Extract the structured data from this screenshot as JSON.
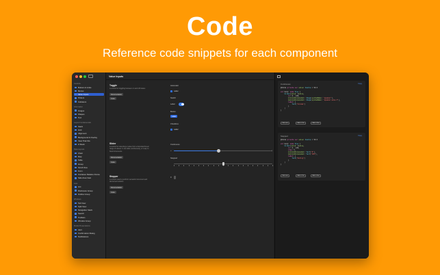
{
  "hero": {
    "title": "Code",
    "subtitle": "Reference code snippets for each component"
  },
  "window": {
    "title": "Value Inputs"
  },
  "sidebar": {
    "sections": [
      {
        "label": "Controls",
        "items": [
          "Buttons & Links",
          "Menus",
          "Value Inputs",
          "Pickers",
          "Indicators"
        ]
      },
      {
        "label": "Information",
        "items": [
          "Images",
          "Shapes",
          "Text"
        ]
      },
      {
        "label": "Layout Fundamentals",
        "items": [
          "Stack",
          "Grid",
          "Alignment",
          "Background & Overlay",
          "View That Fits",
          "Z-Stack"
        ]
      },
      {
        "label": "Data Layouts",
        "items": [
          "Chart",
          "Map",
          "Table",
          "Group",
          "Scroll View",
          "Form",
          "Container Relative Frame",
          "Safe Area Inset"
        ]
      },
      {
        "label": "Lists",
        "items": [
          "List",
          "Disclosure Group",
          "Outline Group"
        ]
      },
      {
        "label": "Windows",
        "items": [
          "Tab View",
          "Split View",
          "Navigation Stack",
          "Search",
          "Toolbars",
          "Window Group"
        ]
      },
      {
        "label": "Modal Presentations",
        "items": [
          "Alert",
          "Confirmation Dialog",
          "Notifications"
        ]
      }
    ],
    "selected": "Value Inputs"
  },
  "toggle": {
    "heading": "Toggle",
    "description": "A control for toggling between on and off states.",
    "doc_button": "Documentation",
    "code_button": "Code",
    "automatic_label": "Automatic",
    "automatic_check": "Label",
    "switch_label": "Switch",
    "switch_text": "Label",
    "button_label": "Button",
    "button_text": "Label",
    "checkbox_label": "Checkbox",
    "checkbox_check": "Label"
  },
  "slider": {
    "heading": "Slider",
    "description": "A control for selecting a value from a bounded linear range of values. It can slide continuously, or snap to fixed increments.",
    "doc_button": "Documentation",
    "code_button": "Code",
    "continuous_label": "Continuous",
    "continuous_value": 0.46,
    "stepped_label": "Stepped",
    "stepped_value": 0.5
  },
  "stepper": {
    "heading": "Stepper",
    "description": "A control used to perform semantic increment and decrement actions.",
    "doc_button": "Documentation",
    "code_button": "Code",
    "value": "0"
  },
  "code_panel": {
    "card1": {
      "title": "Continuous",
      "copy": "Copy",
      "lines": [
        "@State private var value: Double = 50.0",
        "",
        "var body: some View {",
        "    Slider(value: $value,",
        "        in: 0...100,",
        "        minimumValueLabel: Image(systemName: \"speaker\"),",
        "        maximumValueLabel: Image(systemName: \"speaker.wave.3\"),",
        "        label: {",
        "            Text(\"Volume\")",
        "        }",
        "    )",
        "}"
      ],
      "buttons": [
        "Edit view",
        "Add to Tab",
        "Add to Box"
      ]
    },
    "card2": {
      "title": "Stepped",
      "copy": "Copy",
      "lines": [
        "@State private var value: Double = 50.0",
        "",
        "var body: some View {",
        "    Slider(value: $value,",
        "        in: 0...100,",
        "        step: 5,",
        "        minimumValueLabel: Text(\"0\"),",
        "        maximumValueLabel: Text(\"100\"),",
        "        label: {",
        "            Text(\"Rating\")",
        "        }",
        "    )",
        "}"
      ],
      "buttons": [
        "Edit view",
        "Add to Tab",
        "Add to Box"
      ]
    }
  },
  "colors": {
    "background": "#ff9a05",
    "accent": "#2e6be5"
  }
}
